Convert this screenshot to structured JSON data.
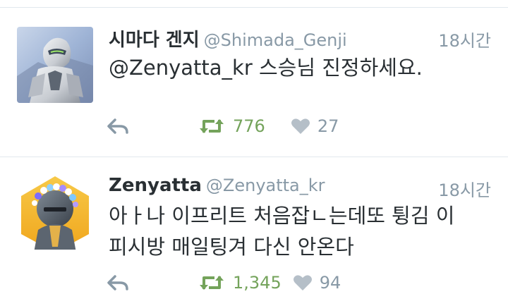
{
  "tweets": [
    {
      "name": "시마다 겐지",
      "handle": "@Shimada_Genji",
      "time": "18시간",
      "text_lines": [
        "@Zenyatta_kr 스승님 진정하세요."
      ],
      "retweets": "776",
      "likes": "27",
      "avatar_icon": "genji-avatar"
    },
    {
      "name": "Zenyatta",
      "handle": "@Zenyatta_kr",
      "time": "18시간",
      "text_lines": [
        "아ㅏ나 이프리트 처음잡ㄴ는데또 튕김 이",
        "피시방 매일팅겨 다신 안온다"
      ],
      "retweets": "1,345",
      "likes": "94",
      "avatar_icon": "zenyatta-avatar"
    }
  ],
  "colors": {
    "retweet": "#74a35b",
    "muted": "#8899a6",
    "divider": "#e1e8ed"
  },
  "icons": [
    "reply-icon",
    "retweet-icon",
    "like-icon"
  ]
}
